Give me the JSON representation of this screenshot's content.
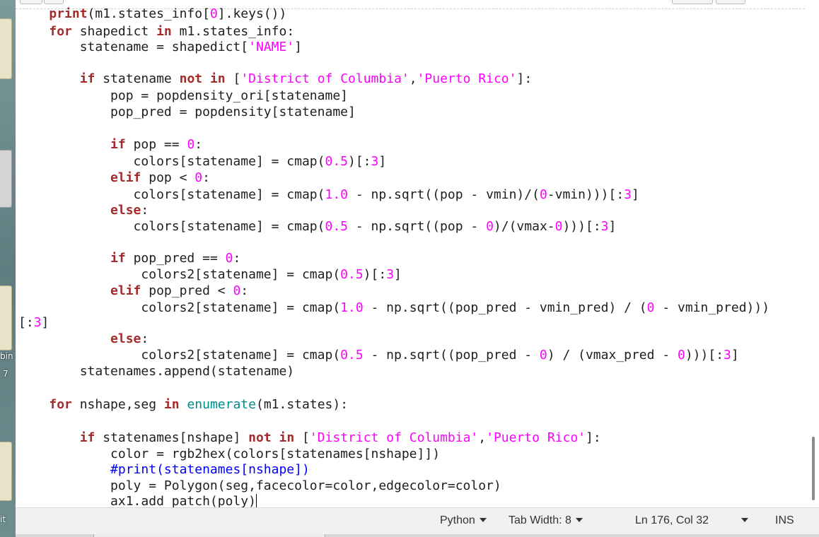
{
  "desktop": {
    "labels": [
      "bin",
      "7",
      "it"
    ]
  },
  "status_bar": {
    "language": "Python",
    "tab_width": "Tab Width: 8",
    "position": "Ln 176, Col 32",
    "mode": "INS"
  },
  "colors": {
    "keyword": "#a52a2a",
    "string": "#ff00ff",
    "number": "#ff00ff",
    "builtin": "#008b8b",
    "comment": "#0000ff"
  }
}
